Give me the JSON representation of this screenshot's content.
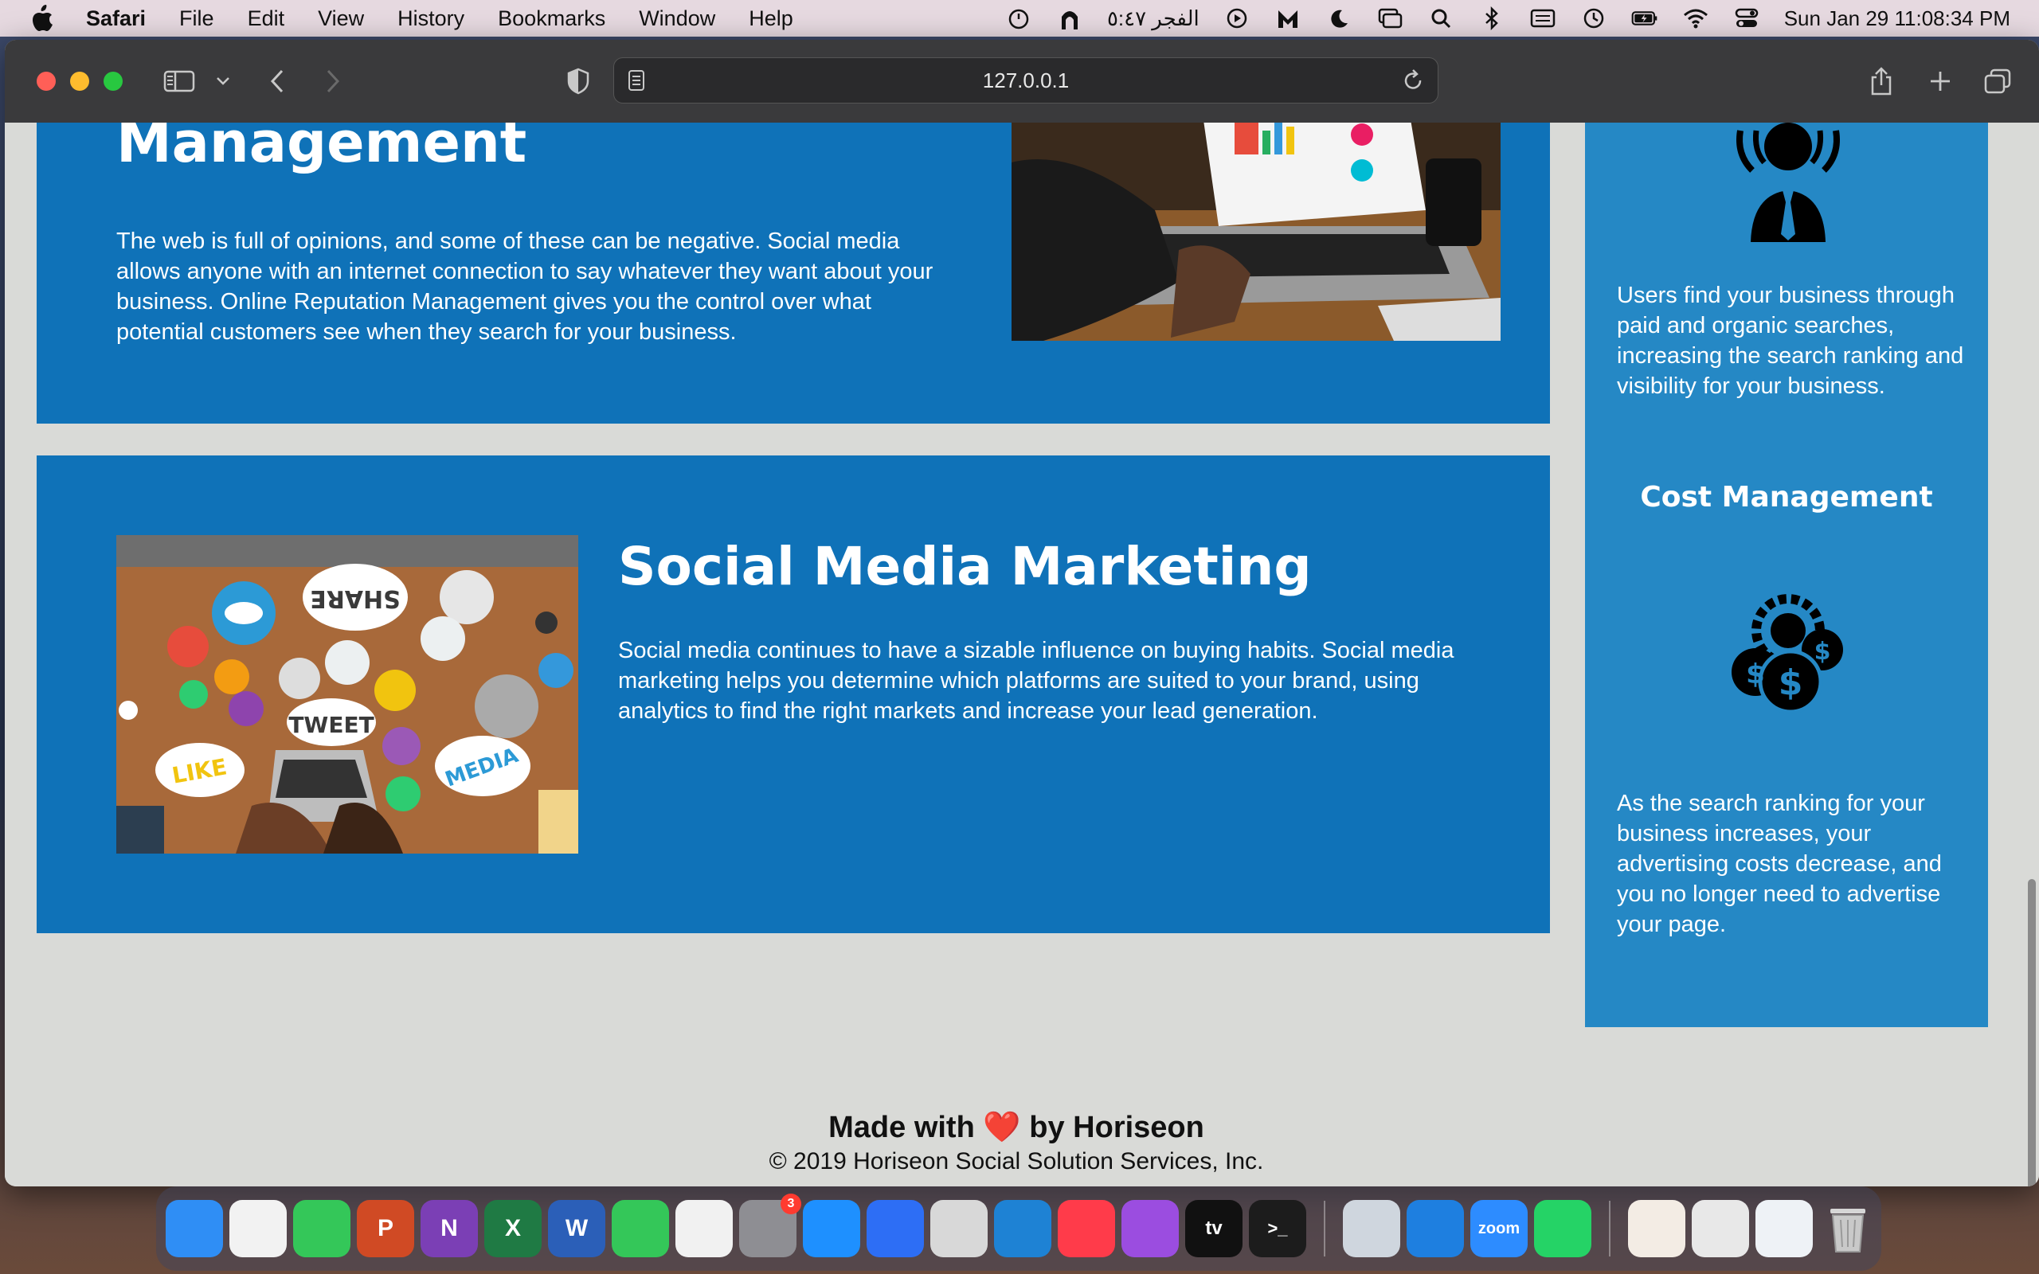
{
  "menubar": {
    "app_name": "Safari",
    "items": [
      "File",
      "Edit",
      "View",
      "History",
      "Bookmarks",
      "Window",
      "Help"
    ],
    "prayer_text": "الفجر ٥:٤٧",
    "datetime": "Sun Jan 29  11:08:34 PM"
  },
  "browser": {
    "url": "127.0.0.1"
  },
  "content": {
    "card1": {
      "heading_fragment": "Management",
      "paragraph": "The web is full of opinions, and some of these can be negative. Social media allows anyone with an internet connection to say whatever they want about your business. Online Reputation Management gives you the control over what potential customers see when they search for your business."
    },
    "card2": {
      "heading": "Social Media Marketing",
      "paragraph": "Social media continues to have a sizable influence on buying habits. Social media marketing helps you determine which platforms are suited to your brand, using analytics to find the right markets and increase your lead generation."
    },
    "aside": {
      "benefit1_text": "Users find your business through paid and organic searches, increasing the search ranking and visibility for your business.",
      "benefit2_title": "Cost Management",
      "benefit2_text": "As the search ranking for your business increases, your advertising costs decrease, and you no longer need to advertise your page."
    }
  },
  "footer": {
    "made_prefix": "Made with",
    "heart": "❤️",
    "made_suffix": "by Horiseon",
    "copyright": "© 2019 Horiseon Social Solution Services, Inc."
  },
  "dock": {
    "apps": [
      {
        "name": "Finder",
        "color": "#2f8ef5",
        "glyph": ""
      },
      {
        "name": "Reminders",
        "color": "#f2f2f2",
        "glyph": ""
      },
      {
        "name": "FaceTime",
        "color": "#34c759",
        "glyph": ""
      },
      {
        "name": "PowerPoint",
        "color": "#d04a24",
        "glyph": "P"
      },
      {
        "name": "OneNote",
        "color": "#7b3fb5",
        "glyph": "N"
      },
      {
        "name": "Excel",
        "color": "#1f7a44",
        "glyph": "X"
      },
      {
        "name": "Word",
        "color": "#2b5fb8",
        "glyph": "W"
      },
      {
        "name": "Messages",
        "color": "#34c759",
        "glyph": ""
      },
      {
        "name": "Chrome",
        "color": "#f1f1f1",
        "glyph": ""
      },
      {
        "name": "System Settings",
        "color": "#8e8e93",
        "glyph": "",
        "badge": "3"
      },
      {
        "name": "Safari",
        "color": "#1e90ff",
        "glyph": ""
      },
      {
        "name": "Pencil",
        "color": "#2d6ef5",
        "glyph": ""
      },
      {
        "name": "QuickTime",
        "color": "#d8d8d8",
        "glyph": ""
      },
      {
        "name": "VS Code",
        "color": "#1e82d4",
        "glyph": ""
      },
      {
        "name": "News",
        "color": "#ff3b4a",
        "glyph": ""
      },
      {
        "name": "Podcasts",
        "color": "#9b4de0",
        "glyph": ""
      },
      {
        "name": "Apple TV",
        "color": "#111111",
        "glyph": "tv"
      },
      {
        "name": "Terminal",
        "color": "#1c1c1c",
        "glyph": ">_"
      }
    ],
    "apps2": [
      {
        "name": "Preview",
        "color": "#cfd6de",
        "glyph": ""
      },
      {
        "name": "OneDrive",
        "color": "#1e7fe0",
        "glyph": ""
      },
      {
        "name": "Zoom",
        "color": "#2d8cff",
        "glyph": "zoom"
      },
      {
        "name": "WhatsApp",
        "color": "#25d366",
        "glyph": ""
      }
    ]
  }
}
